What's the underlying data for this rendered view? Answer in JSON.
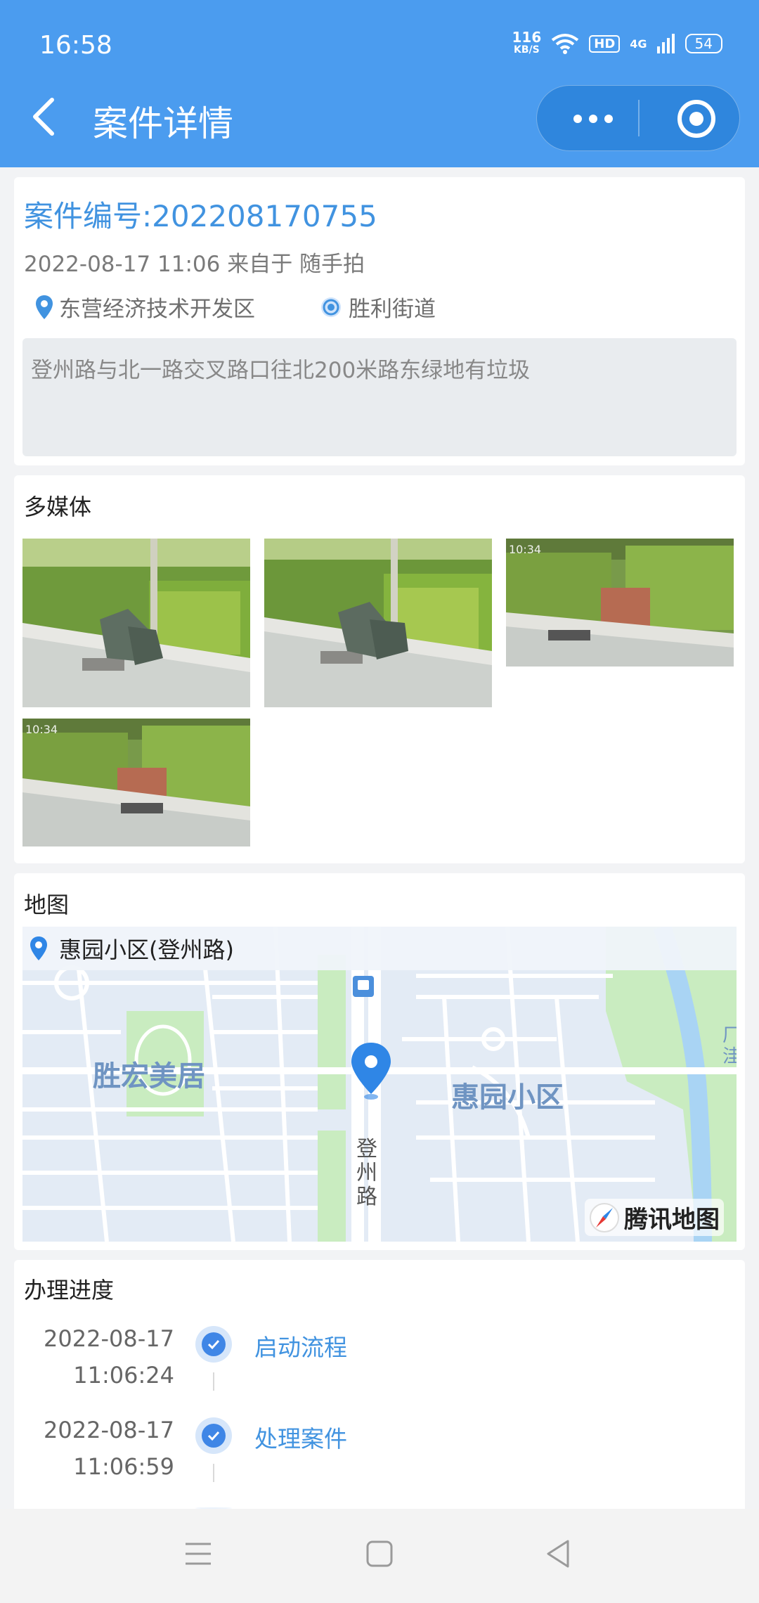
{
  "status_bar": {
    "time": "16:58",
    "net_speed": "116",
    "net_unit": "KB/S",
    "hd": "HD",
    "signal": "4G",
    "battery": "54"
  },
  "nav": {
    "title": "案件详情",
    "back_icon": "chevron-left-icon",
    "more_icon": "more-dots-icon",
    "close_icon": "target-circle-icon"
  },
  "case": {
    "number": "案件编号:202208170755",
    "meta": "2022-08-17 11:06 来自于 随手拍",
    "district": "东营经济技术开发区",
    "street": "胜利街道",
    "description": "登州路与北一路交叉路口往北200米路东绿地有垃圾"
  },
  "media": {
    "title": "多媒体",
    "photos": [
      {
        "name": "photo-1",
        "timestamp": ""
      },
      {
        "name": "photo-2",
        "timestamp": ""
      },
      {
        "name": "photo-3",
        "timestamp": "10:34"
      },
      {
        "name": "photo-4",
        "timestamp": "10:34"
      }
    ]
  },
  "map": {
    "title": "地图",
    "location": "惠园小区(登州路)",
    "labels": {
      "area_left": "胜宏美居",
      "area_right": "惠园小区",
      "road": "登\n州\n路",
      "edge": "厂\n洼"
    },
    "provider": "腾讯地图"
  },
  "progress": {
    "title": "办理进度",
    "steps": [
      {
        "date": "2022-08-17",
        "time": "11:06:24",
        "label": "启动流程"
      },
      {
        "date": "2022-08-17",
        "time": "11:06:59",
        "label": "处理案件"
      }
    ]
  },
  "colors": {
    "header": "#4b9cef",
    "accent": "#4193e0",
    "map_bg": "#e3ebf5",
    "green": "#c9ecc0",
    "water": "#a9d4f4"
  }
}
